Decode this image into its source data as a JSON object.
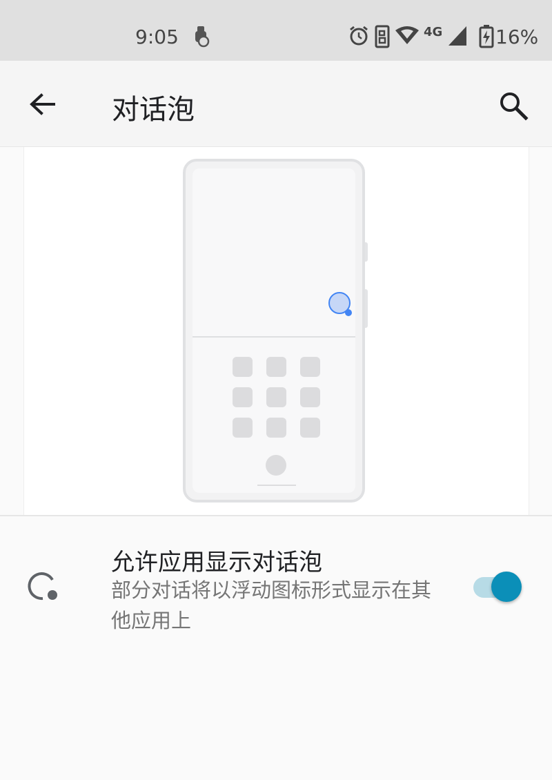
{
  "status_bar": {
    "time": "9:05",
    "battery_percent": "16%",
    "icons": [
      "hand-notification-icon",
      "alarm-icon",
      "data-saver-icon",
      "wifi-icon",
      "4g-icon",
      "signal-icon",
      "battery-charging-icon"
    ],
    "network_label": "4G"
  },
  "app_bar": {
    "title": "对话泡",
    "back_icon": "arrow-back-icon",
    "search_icon": "search-icon"
  },
  "illustration": {
    "description_icon": "phone-bubble-illustration",
    "accent_color": "#4285f4"
  },
  "setting": {
    "icon": "bubble-icon",
    "title": "允许应用显示对话泡",
    "summary": "部分对话将以浮动图标形式显示在其他应用上",
    "enabled": true,
    "accent_color": "#0b8fb8"
  }
}
